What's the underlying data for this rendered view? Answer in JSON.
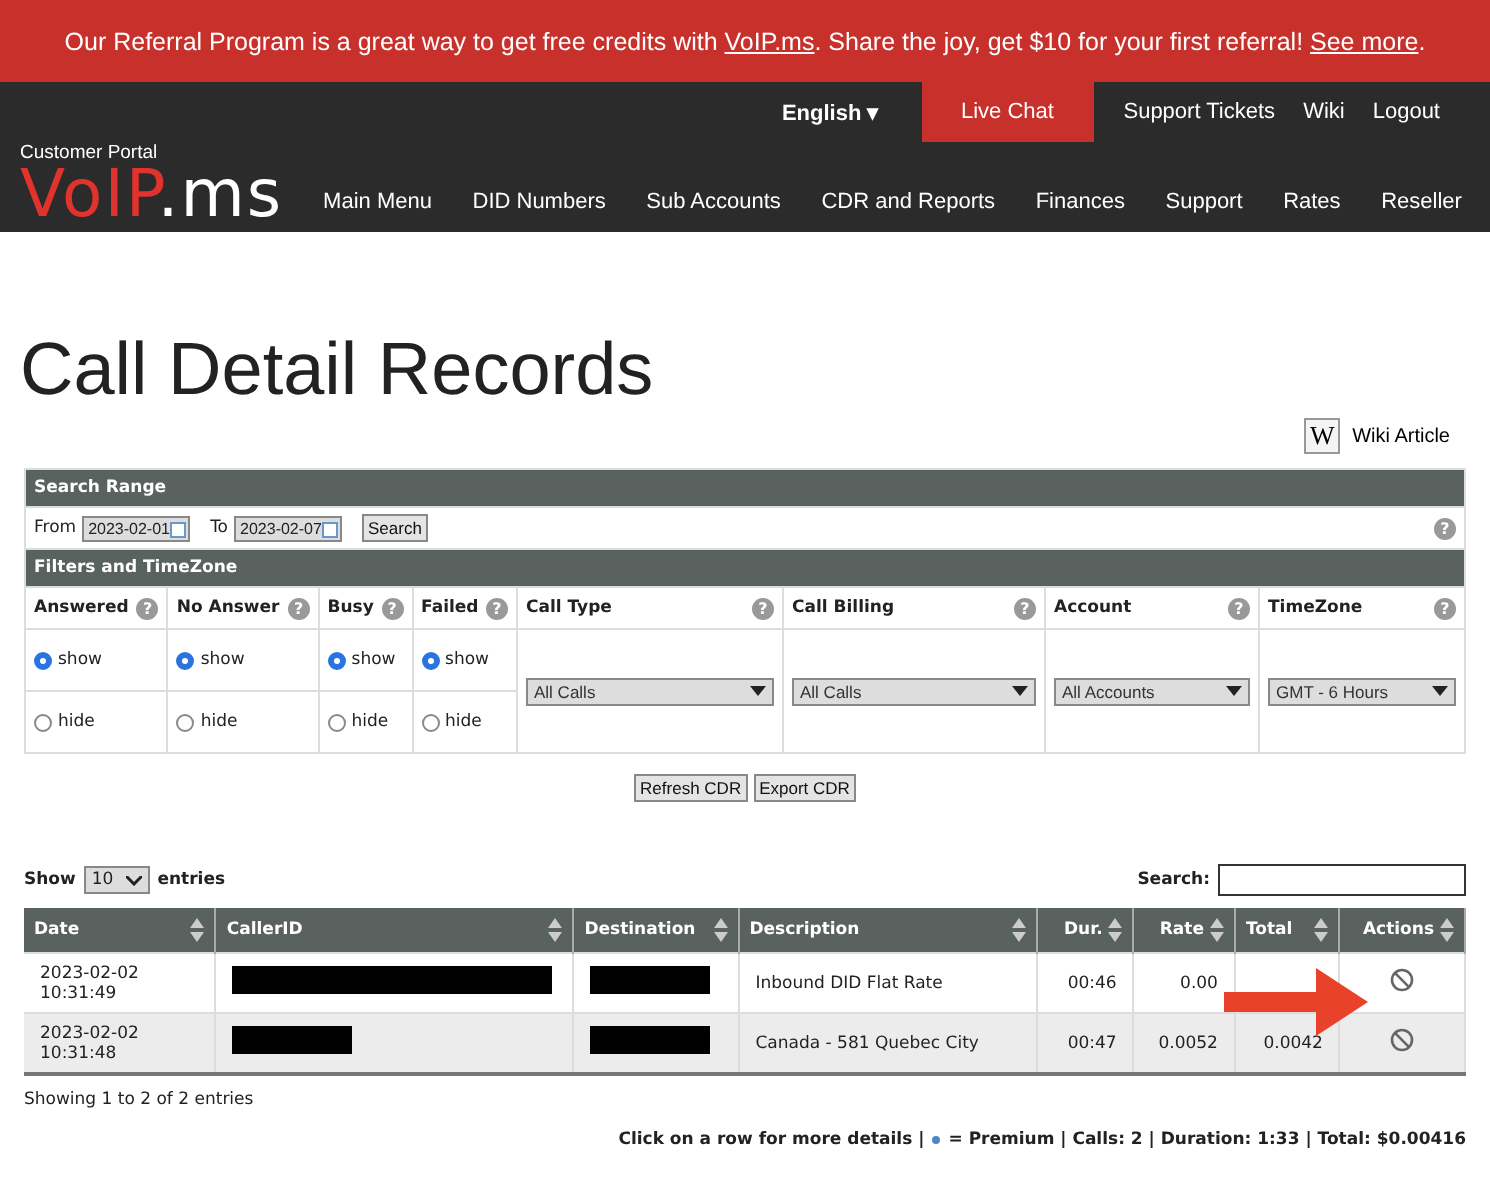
{
  "banner": {
    "before": "Our Referral Program is a great way to get free credits with ",
    "link": "VoIP.ms",
    "middle": ". Share the joy, get $10 for your first referral! ",
    "link2": "See more",
    "after": "."
  },
  "top_nav": {
    "language": "English",
    "caret": "▾",
    "items": [
      {
        "label": "Live Chat",
        "kind": "highlight"
      },
      {
        "label": "Support Tickets",
        "kind": "link"
      },
      {
        "label": "Wiki",
        "kind": "link"
      },
      {
        "label": "Logout",
        "kind": "link"
      }
    ]
  },
  "logo": {
    "caption": "Customer Portal",
    "primary": "VoIP",
    "secondary": ".ms"
  },
  "main_nav": [
    "Main Menu",
    "DID Numbers",
    "Sub Accounts",
    "CDR and Reports",
    "Finances",
    "Support",
    "Rates",
    "Reseller"
  ],
  "page_title": "Call Detail Records",
  "wiki": {
    "icon": "W",
    "label": "Wiki Article"
  },
  "search_range": {
    "title": "Search Range",
    "from_label": "From",
    "from": "2023-02-01",
    "to_label": "To",
    "to": "2023-02-07",
    "button": "Search",
    "help": "?"
  },
  "filters": {
    "title": "Filters and TimeZone",
    "radios": [
      {
        "label": "Answered",
        "help": "?",
        "options": [
          {
            "label": "show",
            "selected": true
          },
          {
            "label": "hide",
            "selected": false
          }
        ]
      },
      {
        "label": "No Answer",
        "help": "?",
        "options": [
          {
            "label": "show",
            "selected": true
          },
          {
            "label": "hide",
            "selected": false
          }
        ]
      },
      {
        "label": "Busy",
        "help": "?",
        "options": [
          {
            "label": "show",
            "selected": true
          },
          {
            "label": "hide",
            "selected": false
          }
        ]
      },
      {
        "label": "Failed",
        "help": "?",
        "options": [
          {
            "label": "show",
            "selected": true
          },
          {
            "label": "hide",
            "selected": false
          }
        ]
      }
    ],
    "selects": [
      {
        "label": "Call Type",
        "help": "?",
        "value": "All Calls"
      },
      {
        "label": "Call Billing",
        "help": "?",
        "value": "All Calls"
      },
      {
        "label": "Account",
        "help": "?",
        "value": "All Accounts"
      },
      {
        "label": "TimeZone",
        "help": "?",
        "value": "GMT - 6 Hours"
      }
    ]
  },
  "buttons": [
    "Refresh CDR",
    "Export CDR"
  ],
  "table_controls": {
    "show_label": "Show",
    "page_size": "10",
    "entries_label": "entries",
    "search_label": "Search:"
  },
  "table": {
    "columns": [
      "Date",
      "CallerID",
      "Destination",
      "Description",
      "Dur.",
      "Rate",
      "Total",
      "Actions"
    ],
    "rows": [
      {
        "date": "2023-02-02",
        "time": "10:31:49",
        "description": "Inbound DID Flat Rate",
        "duration": "00:46",
        "rate": "0.00",
        "total": ""
      },
      {
        "date": "2023-02-02",
        "time": "10:31:48",
        "description": "Canada - 581 Quebec City",
        "duration": "00:47",
        "rate": "0.0052",
        "total": "0.0042"
      }
    ]
  },
  "info": "Showing 1 to 2 of 2 entries",
  "summary": {
    "before": "Click on a row for more details |",
    "after": "= Premium | Calls: 2 | Duration: 1:33 | Total: $0.00416"
  }
}
